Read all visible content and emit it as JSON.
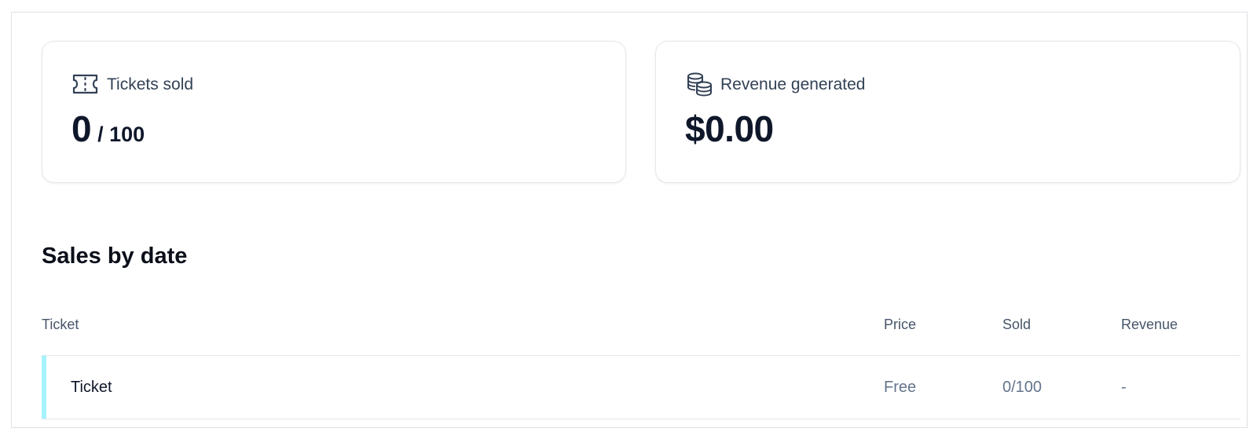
{
  "stats": {
    "tickets": {
      "icon": "ticket-icon",
      "label": "Tickets sold",
      "sold": "0",
      "capacity": "/ 100"
    },
    "revenue": {
      "icon": "coins-icon",
      "label": "Revenue generated",
      "value": "$0.00"
    }
  },
  "sales": {
    "title": "Sales by date",
    "columns": {
      "ticket": "Ticket",
      "price": "Price",
      "sold": "Sold",
      "revenue": "Revenue"
    },
    "rows": [
      {
        "name": "Ticket",
        "price": "Free",
        "sold": "0/100",
        "revenue": "-",
        "accent_color": "#a5f3fc"
      }
    ]
  },
  "colors": {
    "accent": "#a5f3fc",
    "text_primary": "#0f172a",
    "text_muted": "#64748b",
    "border": "#e5e7eb"
  }
}
